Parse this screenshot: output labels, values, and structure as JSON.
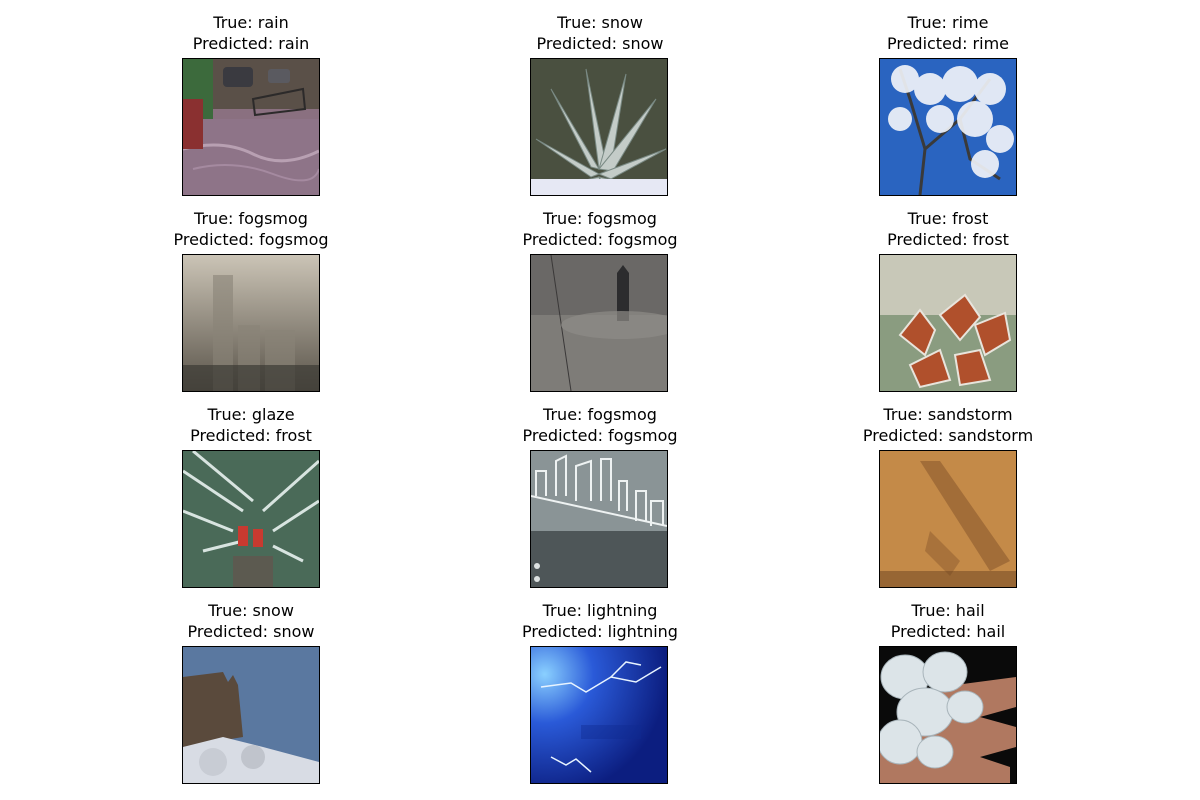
{
  "grid": [
    {
      "true_label": "True: rain",
      "predicted_label": "Predicted: rain",
      "image_kind": "street-flood-scene"
    },
    {
      "true_label": "True: snow",
      "predicted_label": "Predicted: snow",
      "image_kind": "snow-covered-agave"
    },
    {
      "true_label": "True: rime",
      "predicted_label": "Predicted: rime",
      "image_kind": "rime-covered-tree"
    },
    {
      "true_label": "True: fogsmog",
      "predicted_label": "Predicted: fogsmog",
      "image_kind": "smoggy-skyline"
    },
    {
      "true_label": "True: fogsmog",
      "predicted_label": "Predicted: fogsmog",
      "image_kind": "tower-in-fog"
    },
    {
      "true_label": "True: frost",
      "predicted_label": "Predicted: frost",
      "image_kind": "frosted-red-leaves"
    },
    {
      "true_label": "True: glaze",
      "predicted_label": "Predicted: frost",
      "image_kind": "icy-trees-with-people"
    },
    {
      "true_label": "True: fogsmog",
      "predicted_label": "Predicted: fogsmog",
      "image_kind": "foggy-city-outline"
    },
    {
      "true_label": "True: sandstorm",
      "predicted_label": "Predicted: sandstorm",
      "image_kind": "sandstorm-haze"
    },
    {
      "true_label": "True: snow",
      "predicted_label": "Predicted: snow",
      "image_kind": "snowy-great-wall"
    },
    {
      "true_label": "True: lightning",
      "predicted_label": "Predicted: lightning",
      "image_kind": "lightning-blue-sky"
    },
    {
      "true_label": "True: hail",
      "predicted_label": "Predicted: hail",
      "image_kind": "hailstones-in-hand"
    }
  ]
}
